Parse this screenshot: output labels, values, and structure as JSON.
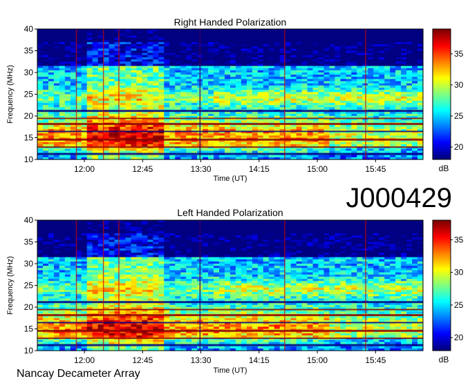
{
  "page": {
    "observation_id": "J000429",
    "instrument": "Nancay Decameter Array"
  },
  "chart_data": [
    {
      "type": "heatmap",
      "title": "Right Handed Polarization",
      "xlabel": "Time (UT)",
      "ylabel": "Frequency (MHz)",
      "colorbar_label": "dB",
      "x_ticks": [
        "12:00",
        "12:45",
        "13:30",
        "14:15",
        "15:00",
        "15:45"
      ],
      "y_ticks": [
        10,
        15,
        20,
        25,
        30,
        35,
        40
      ],
      "ylim": [
        10,
        40
      ],
      "colorbar_ticks": [
        20,
        25,
        30,
        35
      ],
      "colorbar_range": [
        18,
        39
      ]
    },
    {
      "type": "heatmap",
      "title": "Left Handed Polarization",
      "xlabel": "Time (UT)",
      "ylabel": "Frequency (MHz)",
      "colorbar_label": "dB",
      "x_ticks": [
        "12:00",
        "12:45",
        "13:30",
        "14:15",
        "15:00",
        "15:45"
      ],
      "y_ticks": [
        10,
        15,
        20,
        25,
        30,
        35,
        40
      ],
      "ylim": [
        10,
        40
      ],
      "colorbar_ticks": [
        20,
        25,
        30,
        35
      ],
      "colorbar_range": [
        18,
        38
      ]
    }
  ]
}
